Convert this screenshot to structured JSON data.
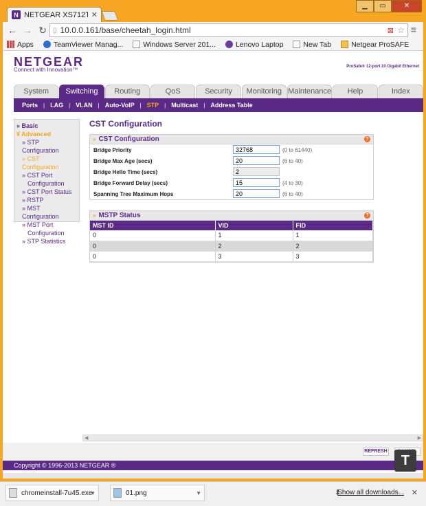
{
  "browser": {
    "tab_title": "NETGEAR XS712T",
    "url": "10.0.0.161/base/cheetah_login.html",
    "bookmarks": [
      {
        "label": "Apps",
        "icon": "apps-grid-icon"
      },
      {
        "label": "TeamViewer Manag...",
        "icon": "teamviewer-icon"
      },
      {
        "label": "Windows Server 201...",
        "icon": "page-icon"
      },
      {
        "label": "Lenovo Laptop",
        "icon": "peace-icon"
      },
      {
        "label": "New Tab",
        "icon": "page-icon"
      },
      {
        "label": "Netgear ProSAFE",
        "icon": "folder-icon"
      }
    ]
  },
  "header": {
    "logo": "NETGEAR",
    "tagline": "Connect with Innovation™",
    "product": "ProSafe® 12-port 10 Gigabit Ethernet"
  },
  "main_tabs": [
    "System",
    "Switching",
    "Routing",
    "QoS",
    "Security",
    "Monitoring",
    "Maintenance",
    "Help",
    "Index"
  ],
  "active_tab": "Switching",
  "sub_tabs": [
    "Ports",
    "LAG",
    "VLAN",
    "Auto-VoIP",
    "STP",
    "Multicast",
    "Address Table"
  ],
  "active_sub": "STP",
  "left_nav": {
    "basic": "» Basic",
    "advanced": "¥ Advanced",
    "items": [
      "» STP Configuration",
      "» CST Configuration",
      "» CST Port",
      "Configuration",
      "» CST Port Status",
      "» RSTP",
      "» MST Configuration",
      "» MST Port",
      "Configuration",
      "» STP Statistics"
    ]
  },
  "page_title": "CST Configuration",
  "cst_panel": {
    "title": "CST Configuration",
    "fields": [
      {
        "label": "Bridge Priority",
        "value": "32768",
        "range": "(0 to 61440)",
        "readonly": false
      },
      {
        "label": "Bridge Max Age (secs)",
        "value": "20",
        "range": "(6 to 40)",
        "readonly": false
      },
      {
        "label": "Bridge Hello Time (secs)",
        "value": "2",
        "range": "",
        "readonly": true
      },
      {
        "label": "Bridge Forward Delay (secs)",
        "value": "15",
        "range": "(4 to 30)",
        "readonly": false
      },
      {
        "label": "Spanning Tree Maximum Hops",
        "value": "20",
        "range": "(6 to 40)",
        "readonly": false
      }
    ]
  },
  "mstp_panel": {
    "title": "MSTP Status",
    "columns": [
      "MST ID",
      "VID",
      "FID"
    ],
    "rows": [
      [
        "0",
        "1",
        "1"
      ],
      [
        "0",
        "2",
        "2"
      ],
      [
        "0",
        "3",
        "3"
      ]
    ]
  },
  "buttons": {
    "refresh": "REFRESH",
    "cancel": "CANCEL"
  },
  "copyright": "Copyright © 1996-2013 NETGEAR ®",
  "downloads": {
    "items": [
      "chromeinstall-7u45.exe",
      "01.png"
    ],
    "show_all": "Show all downloads..."
  },
  "colors": {
    "brand_purple": "#5a2a86",
    "accent_orange": "#f6a623"
  }
}
